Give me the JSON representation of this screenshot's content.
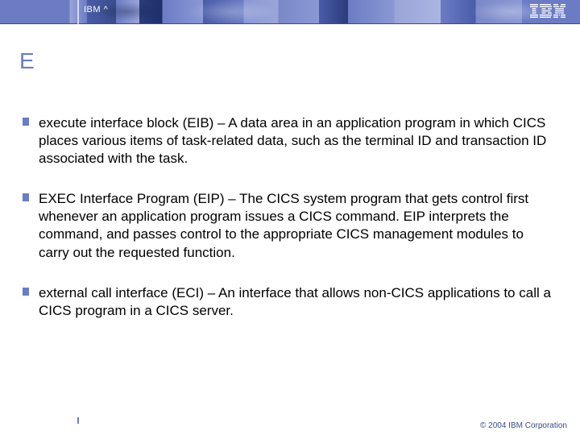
{
  "header": {
    "label": "IBM ^"
  },
  "slide": {
    "letter": "E",
    "bullets": [
      "execute interface block (EIB) – A data area in an application program in which CICS places various items of task-related data, such as the terminal ID and transaction ID associated with the task.",
      "EXEC Interface Program (EIP) – The CICS system program that gets control first whenever an application program issues a CICS command. EIP interprets the command, and passes control to the appropriate CICS management modules to carry out the requested function.",
      "external call interface (ECI) – An interface that allows non-CICS applications to call a CICS program in a CICS server."
    ]
  },
  "footer": {
    "copyright": "© 2004 IBM Corporation"
  }
}
